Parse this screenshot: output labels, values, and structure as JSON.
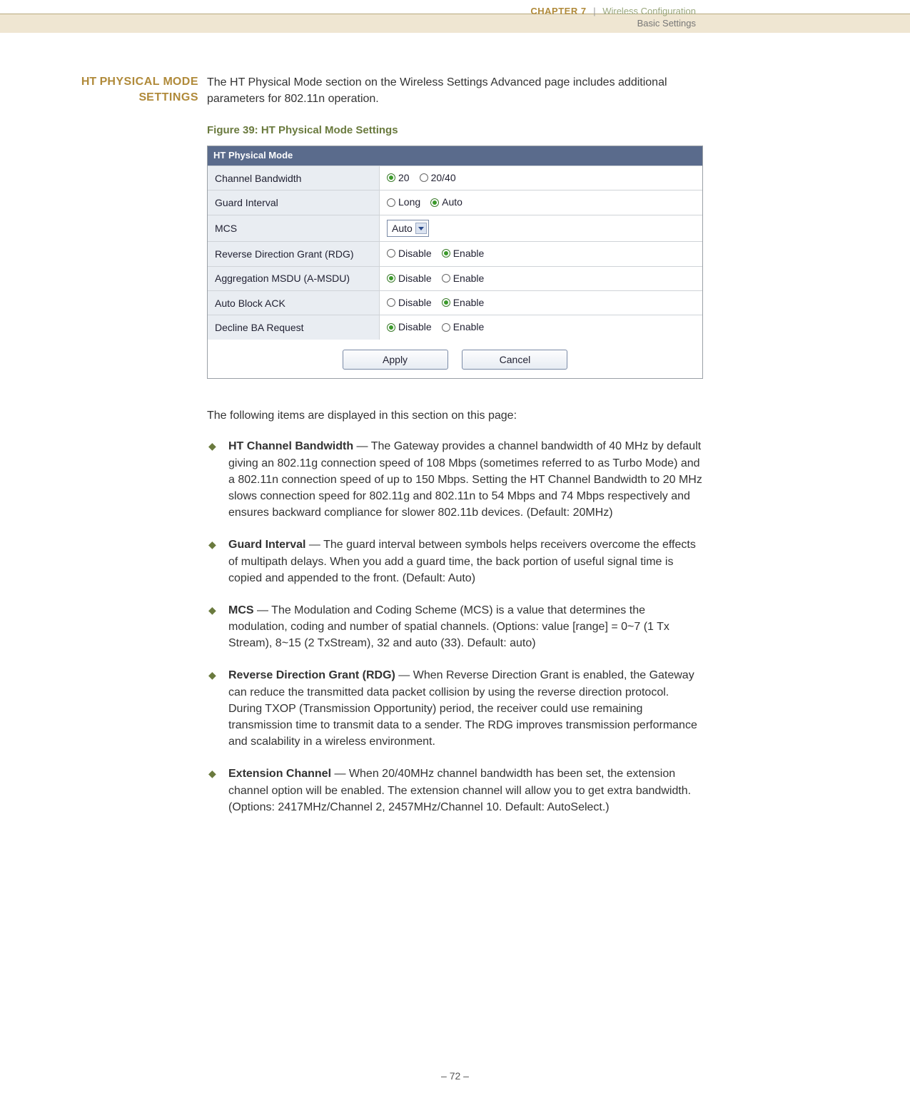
{
  "header": {
    "chapter": "CHAPTER 7",
    "separator": "|",
    "section": "Wireless Configuration",
    "subsection": "Basic Settings"
  },
  "side_heading_1": "HT P",
  "side_heading_2": "HYSICAL",
  "side_heading_3": " M",
  "side_heading_4": "ODE",
  "side_heading_5": "S",
  "side_heading_6": "ETTINGS",
  "intro": "The HT Physical Mode section on the Wireless Settings Advanced page includes additional parameters for 802.11n operation.",
  "figure_caption": "Figure 39:  HT Physical Mode Settings",
  "shot": {
    "title": "HT Physical Mode",
    "rows": [
      {
        "label": "Channel Bandwidth",
        "opts": [
          {
            "t": "20",
            "sel": true
          },
          {
            "t": "20/40",
            "sel": false
          }
        ]
      },
      {
        "label": "Guard Interval",
        "opts": [
          {
            "t": "Long",
            "sel": false
          },
          {
            "t": "Auto",
            "sel": true
          }
        ]
      },
      {
        "label": "MCS",
        "select": "Auto"
      },
      {
        "label": "Reverse Direction Grant (RDG)",
        "opts": [
          {
            "t": "Disable",
            "sel": false
          },
          {
            "t": "Enable",
            "sel": true
          }
        ]
      },
      {
        "label": "Aggregation MSDU (A-MSDU)",
        "opts": [
          {
            "t": "Disable",
            "sel": true
          },
          {
            "t": "Enable",
            "sel": false
          }
        ]
      },
      {
        "label": "Auto Block ACK",
        "opts": [
          {
            "t": "Disable",
            "sel": false
          },
          {
            "t": "Enable",
            "sel": true
          }
        ]
      },
      {
        "label": "Decline BA Request",
        "opts": [
          {
            "t": "Disable",
            "sel": true
          },
          {
            "t": "Enable",
            "sel": false
          }
        ]
      }
    ],
    "apply": "Apply",
    "cancel": "Cancel"
  },
  "lead": "The following items are displayed in this section on this page:",
  "items": [
    {
      "term": "HT Channel Bandwidth",
      "desc": " — The Gateway provides a channel bandwidth of 40 MHz by default giving an 802.11g connection speed of 108 Mbps (sometimes referred to as Turbo Mode) and a 802.11n connection speed of up to 150 Mbps. Setting the HT Channel Bandwidth to 20 MHz slows connection speed for 802.11g and 802.11n to 54 Mbps and 74 Mbps respectively and ensures backward compliance for slower 802.11b devices. (Default: 20MHz)"
    },
    {
      "term": "Guard Interval",
      "desc": " — The guard interval between symbols helps receivers overcome the effects of multipath delays. When you add a guard time, the back portion of useful signal time is copied and appended to the front. (Default: Auto)"
    },
    {
      "term": "MCS",
      "desc": " — The Modulation and Coding Scheme (MCS) is a value that determines the modulation, coding and number of spatial channels. (Options: value [range] = 0~7 (1 Tx Stream), 8~15 (2 TxStream), 32 and auto (33). Default: auto)"
    },
    {
      "term": "Reverse Direction Grant (RDG)",
      "desc": " — When Reverse Direction Grant is enabled, the Gateway can reduce the transmitted data packet collision by using the reverse direction protocol. During TXOP (Transmission Opportunity) period, the receiver could use remaining transmission time to transmit data to a sender. The RDG improves transmission performance and scalability in a wireless environment."
    },
    {
      "term": "Extension Channel",
      "desc": " — When 20/40MHz channel bandwidth has been set, the extension channel option will be enabled. The extension channel will allow you to get extra bandwidth. (Options: 2417MHz/Channel 2, 2457MHz/Channel 10. Default: AutoSelect.)"
    }
  ],
  "page_number": "–  72  –"
}
